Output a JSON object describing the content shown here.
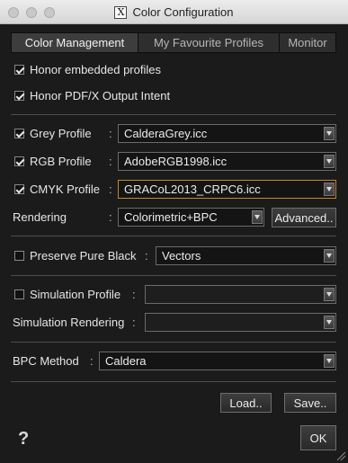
{
  "window": {
    "title": "Color Configuration",
    "app_icon": "X"
  },
  "tabs": [
    {
      "label": "Color Management",
      "active": true
    },
    {
      "label": "My Favourite Profiles",
      "active": false
    },
    {
      "label": "Monitor",
      "active": false
    }
  ],
  "options": {
    "honor_embedded": {
      "label": "Honor embedded profiles",
      "checked": true
    },
    "honor_pdfx": {
      "label": "Honor PDF/X Output Intent",
      "checked": true
    }
  },
  "profiles": {
    "grey": {
      "label": "Grey Profile",
      "checked": true,
      "value": "CalderaGrey.icc"
    },
    "rgb": {
      "label": "RGB Profile",
      "checked": true,
      "value": "AdobeRGB1998.icc"
    },
    "cmyk": {
      "label": "CMYK Profile",
      "checked": true,
      "value": "GRACoL2013_CRPC6.icc"
    }
  },
  "rendering": {
    "label": "Rendering",
    "value": "Colorimetric+BPC",
    "advanced_label": "Advanced.."
  },
  "preserve_black": {
    "label": "Preserve Pure Black",
    "checked": false,
    "value": "Vectors"
  },
  "simulation": {
    "profile_label": "Simulation Profile",
    "checked": false,
    "profile_value": "",
    "rendering_label": "Simulation Rendering",
    "rendering_value": ""
  },
  "bpc": {
    "label": "BPC Method",
    "value": "Caldera"
  },
  "buttons": {
    "load": "Load..",
    "save": "Save..",
    "ok": "OK",
    "help": "?"
  },
  "colors": {
    "background": "#1b1b1b",
    "focus_border": "#c58a2c",
    "text": "#e6e6e6"
  }
}
